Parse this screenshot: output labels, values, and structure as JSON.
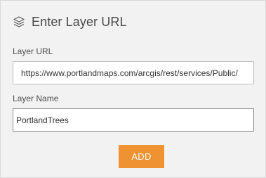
{
  "header": {
    "icon": "layers-icon",
    "title": "Enter Layer URL"
  },
  "form": {
    "layer_url": {
      "label": "Layer URL",
      "value": "https://www.portlandmaps.com/arcgis/rest/services/Public/"
    },
    "layer_name": {
      "label": "Layer Name",
      "value": "PortlandTrees"
    },
    "add_label": "ADD"
  },
  "colors": {
    "panel_background": "#f2f2f2",
    "accent_button": "#ee9232",
    "text": "#4a4a4a"
  }
}
